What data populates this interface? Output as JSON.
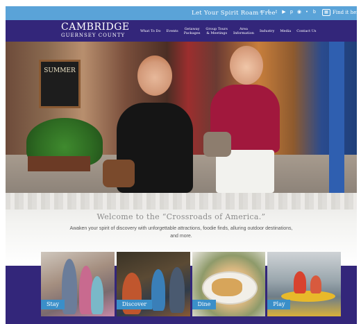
{
  "topbar": {
    "tagline": "Let Your Spirit Roam Free",
    "social_icons": [
      "search-icon",
      "facebook-icon",
      "twitter-icon",
      "youtube-icon",
      "pinterest-icon",
      "instagram-icon",
      "flickr-icon",
      "blogger-icon"
    ],
    "find_label": "Find it here"
  },
  "logo": {
    "line1": "CAMBRIDGE",
    "line2": "GUERNSEY COUNTY"
  },
  "nav": {
    "items": [
      "What To Do",
      "Events",
      "Getaway\nPackages",
      "Group Tours\n& Meetings",
      "Area\nInformation",
      "Industry",
      "Media",
      "Contact Us"
    ]
  },
  "hero": {
    "sign_text": "SUMMER"
  },
  "welcome": {
    "title": "Welcome to the “Crossroads of America.”",
    "subtitle": "Awaken your spirit of discovery with unforgettable attractions, foodie finds, alluring outdoor destinations, and more."
  },
  "cards": [
    {
      "label": "Stay"
    },
    {
      "label": "Discover"
    },
    {
      "label": "Dine"
    },
    {
      "label": "Play"
    }
  ],
  "colors": {
    "topbar": "#5aa3d8",
    "nav": "#33267a",
    "card_label": "#3a8fc9"
  }
}
